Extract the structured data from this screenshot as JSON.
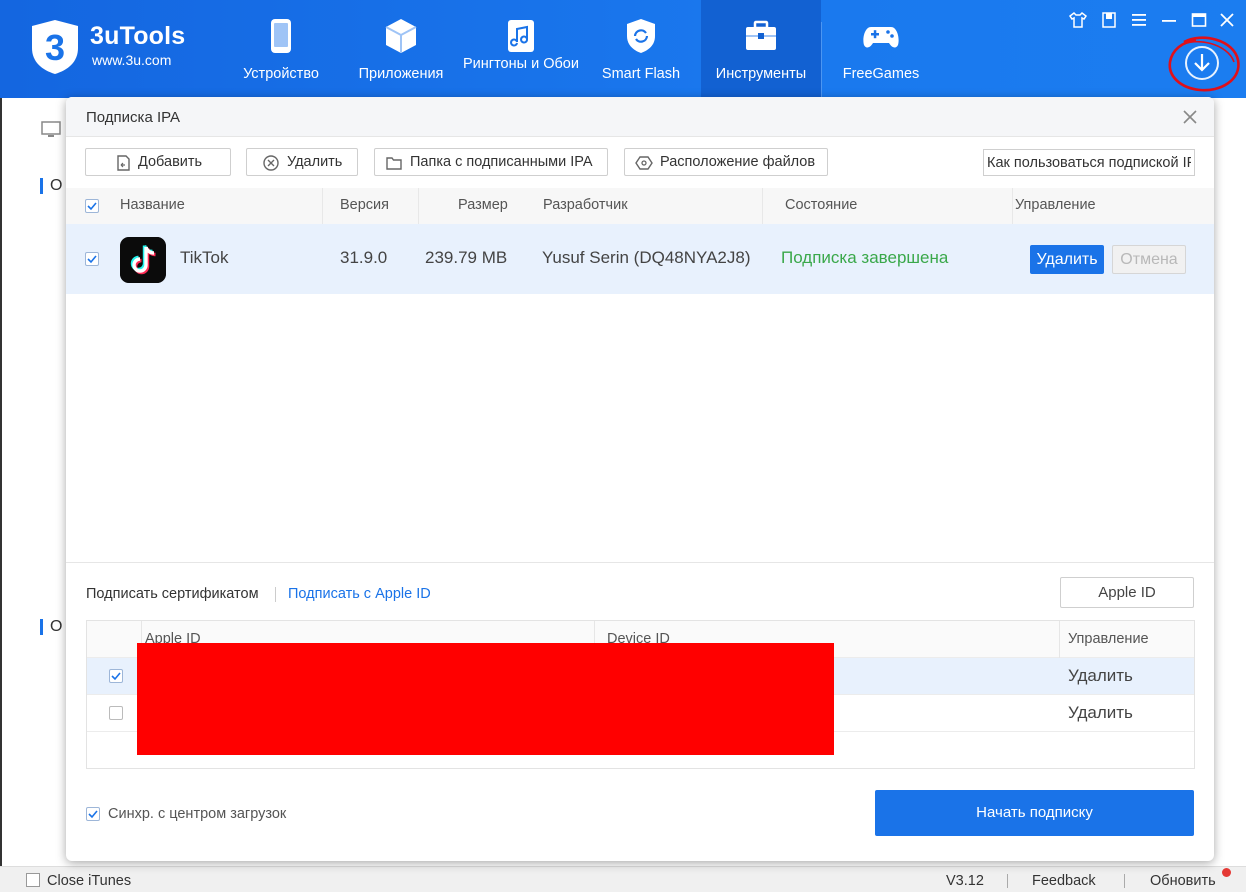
{
  "app": {
    "logo_text": "3uTools",
    "logo_sub": "www.3u.com",
    "accent": "#1a73e8"
  },
  "nav": {
    "items": [
      {
        "label": "Устройство",
        "icon": "phone-icon"
      },
      {
        "label": "Приложения",
        "icon": "cube-icon"
      },
      {
        "label": "Рингтоны и Обои",
        "icon": "music-note-icon"
      },
      {
        "label": "Smart Flash",
        "icon": "shield-refresh-icon"
      },
      {
        "label": "Инструменты",
        "icon": "toolbox-icon"
      },
      {
        "label": "FreeGames",
        "icon": "gamepad-icon"
      }
    ],
    "active_index": 4
  },
  "dialog": {
    "title": "Подписка IPA",
    "toolbar": {
      "add_label": "Добавить",
      "delete_label": "Удалить",
      "signed_folder_label": "Папка с подписанными IPA",
      "file_location_label": "Расположение файлов",
      "help_value": "Как пользоваться подпиской IPA"
    },
    "table": {
      "columns": [
        "Название",
        "Версия",
        "Размер",
        "Разработчик",
        "Состояние",
        "Управление"
      ],
      "rows": [
        {
          "name": "TikTok",
          "version": "31.9.0",
          "size": "239.79 MB",
          "developer": "Yusuf Serin (DQ48NYA2J8)",
          "status": "Подписка завершена",
          "delete_label": "Удалить",
          "cancel_label": "Отмена",
          "checked": true
        }
      ]
    },
    "sign_tabs": {
      "cert_label": "Подписать сертификатом",
      "appleid_label": "Подписать с Apple ID"
    },
    "appleid_button": "Apple ID",
    "accounts": {
      "columns": [
        "Apple ID",
        "Device ID",
        "Управление"
      ],
      "rows": [
        {
          "delete_label": "Удалить",
          "checked": true
        },
        {
          "delete_label": "Удалить",
          "checked": false
        }
      ]
    },
    "sync_label": "Синхр. с центром загрузок",
    "sync_checked": true,
    "start_button": "Начать подписку"
  },
  "status_bar": {
    "close_itunes": "Close iTunes",
    "version": "V3.12",
    "feedback": "Feedback",
    "update": "Обновить"
  }
}
